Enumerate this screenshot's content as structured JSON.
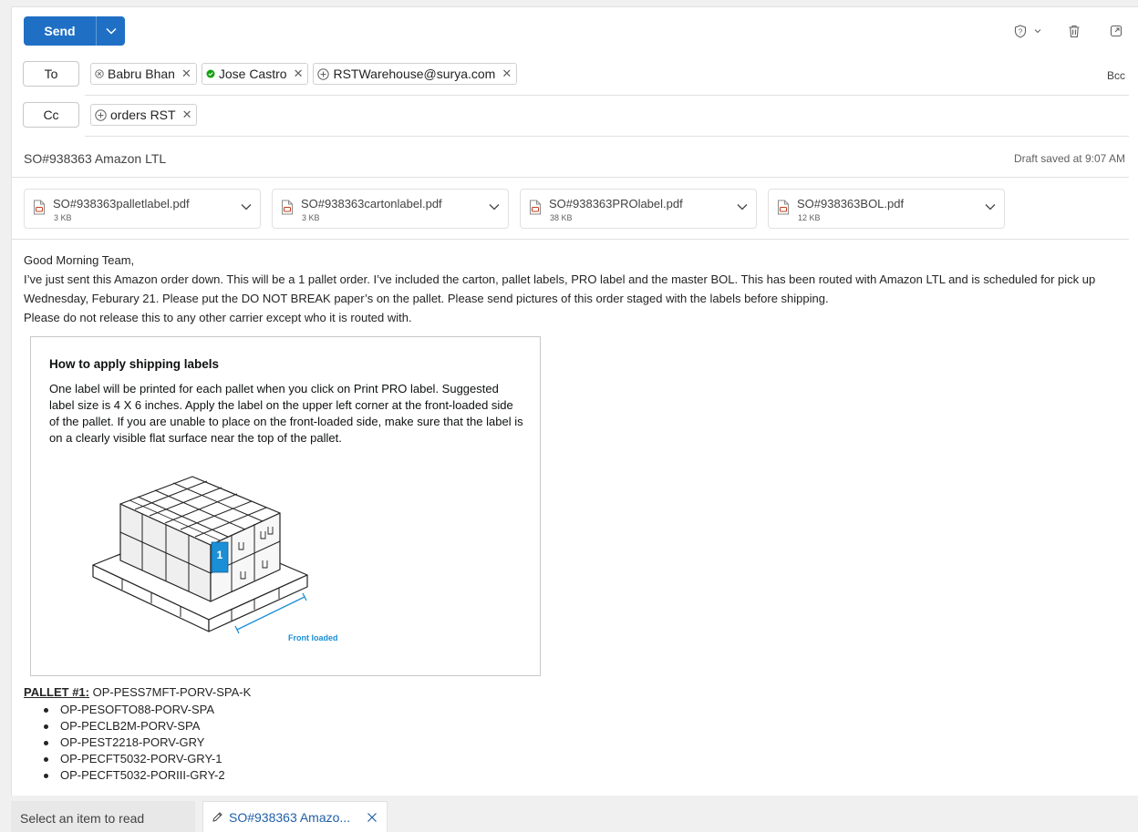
{
  "toolbar": {
    "send_label": "Send",
    "icons": [
      "send-options-chevron-icon",
      "sensitivity-icon",
      "chevron-down-icon",
      "delete-icon",
      "pop-out-icon"
    ]
  },
  "recipients": {
    "to_label": "To",
    "to": [
      {
        "name": "Babru Bhan",
        "status": "blocked"
      },
      {
        "name": "Jose Castro",
        "status": "available"
      },
      {
        "name": "RSTWarehouse@surya.com",
        "status": "external"
      }
    ],
    "cc_label": "Cc",
    "cc": [
      {
        "name": "orders RST",
        "status": "group"
      }
    ],
    "bcc_label": "Bcc"
  },
  "subject": "SO#938363 Amazon LTL",
  "draft_status": "Draft saved at 9:07 AM",
  "attachments": [
    {
      "name": "SO#938363palletlabel.pdf",
      "size": "3 KB"
    },
    {
      "name": "SO#938363cartonlabel.pdf",
      "size": "3 KB"
    },
    {
      "name": "SO#938363PROlabel.pdf",
      "size": "38 KB"
    },
    {
      "name": "SO#938363BOL.pdf",
      "size": "12 KB"
    }
  ],
  "body": {
    "greeting": "Good Morning Team,",
    "paragraph1": "I’ve just sent this Amazon order down. This will be a 1 pallet order. I’ve included the carton, pallet labels, PRO label and the master BOL. This has been routed with Amazon LTL and is scheduled for pick up Wednesday, Feburary 21. Please put the DO NOT BREAK paper’s on the pallet. Please send pictures of this order staged with the labels before shipping.",
    "paragraph2": "Please do not release this to any other carrier except who it is routed with."
  },
  "infobox": {
    "title": "How to apply shipping labels",
    "text": "One label will be printed for each pallet when you click on Print PRO label. Suggested label size is 4 X 6 inches. Apply the label on the upper left corner at the front-loaded side of the pallet. If you are unable to place on the front-loaded side, make sure that the label is on a clearly visible flat surface near the top of the pallet.",
    "label_number": "1",
    "front_loaded": "Front loaded"
  },
  "pallet": {
    "label": "PALLET #1:",
    "id": "OP-PESS7MFT-PORV-SPA-K",
    "items": [
      "OP-PESOFTO88-PORV-SPA",
      "OP-PECLB2M-PORV-SPA",
      "OP-PEST2218-PORV-GRY",
      "OP-PECFT5032-PORV-GRY-1",
      "OP-PECFT5032-PORIII-GRY-2"
    ]
  },
  "tabs": {
    "read_label": "Select an item to read",
    "draft_label": "SO#938363 Amazo..."
  },
  "colors": {
    "accent": "#1f6fc5",
    "label_blue": "#1a8fd6",
    "available_green": "#13a10e"
  }
}
